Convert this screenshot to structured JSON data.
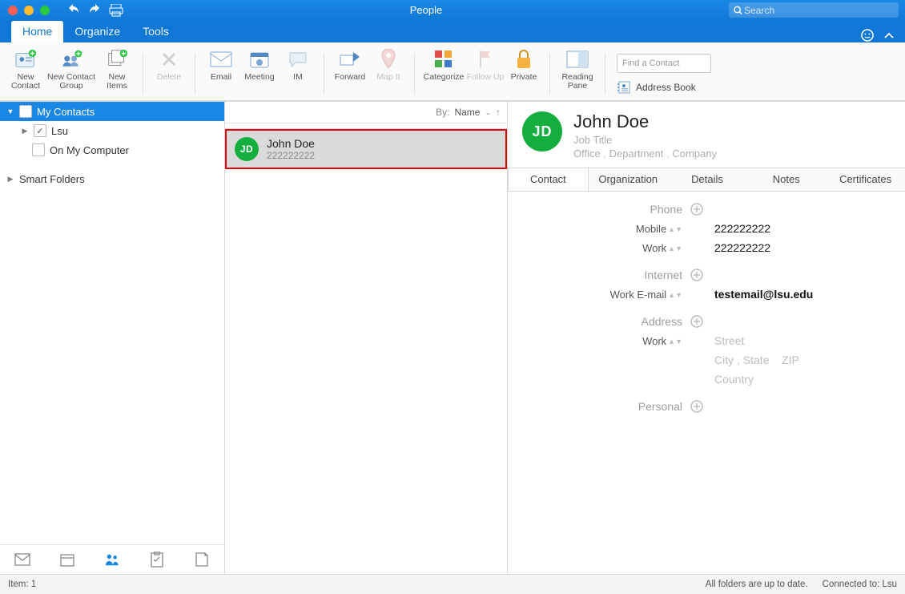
{
  "window": {
    "title": "People",
    "search_placeholder": "Search"
  },
  "menu_tabs": {
    "home": "Home",
    "organize": "Organize",
    "tools": "Tools"
  },
  "ribbon": {
    "new_contact": "New Contact",
    "new_contact_group": "New Contact Group",
    "new_items": "New Items",
    "delete": "Delete",
    "email": "Email",
    "meeting": "Meeting",
    "im": "IM",
    "forward": "Forward",
    "map_it": "Map It",
    "categorize": "Categorize",
    "follow_up": "Follow Up",
    "private": "Private",
    "reading_pane": "Reading Pane",
    "find_contact_placeholder": "Find a Contact",
    "address_book": "Address Book"
  },
  "sidebar": {
    "my_contacts": "My Contacts",
    "items": [
      {
        "label": "Lsu",
        "checked": true
      },
      {
        "label": "On My Computer",
        "checked": false
      }
    ],
    "smart_folders": "Smart Folders"
  },
  "list": {
    "sort_prefix": "By:",
    "sort_value": "Name",
    "items": [
      {
        "initials": "JD",
        "name": "John Doe",
        "sub": "222222222"
      }
    ]
  },
  "contact": {
    "initials": "JD",
    "name": "John  Doe",
    "job": "Job Title",
    "office": "Office",
    "department": "Department",
    "company": "Company",
    "tabs": {
      "contact": "Contact",
      "organization": "Organization",
      "details": "Details",
      "notes": "Notes",
      "certificates": "Certificates"
    },
    "sections": {
      "phone": "Phone",
      "mobile_label": "Mobile",
      "mobile_val": "222222222",
      "work_label": "Work",
      "work_val": "222222222",
      "internet": "Internet",
      "work_email_label": "Work E-mail",
      "work_email_val": "testemail@lsu.edu",
      "address": "Address",
      "addr_work_label": "Work",
      "street": "Street",
      "city": "City",
      "state": "State",
      "zip": "ZIP",
      "country": "Country",
      "personal": "Personal"
    }
  },
  "status": {
    "item_count": "Item: 1",
    "sync": "All folders are up to date.",
    "conn": "Connected to: Lsu"
  }
}
